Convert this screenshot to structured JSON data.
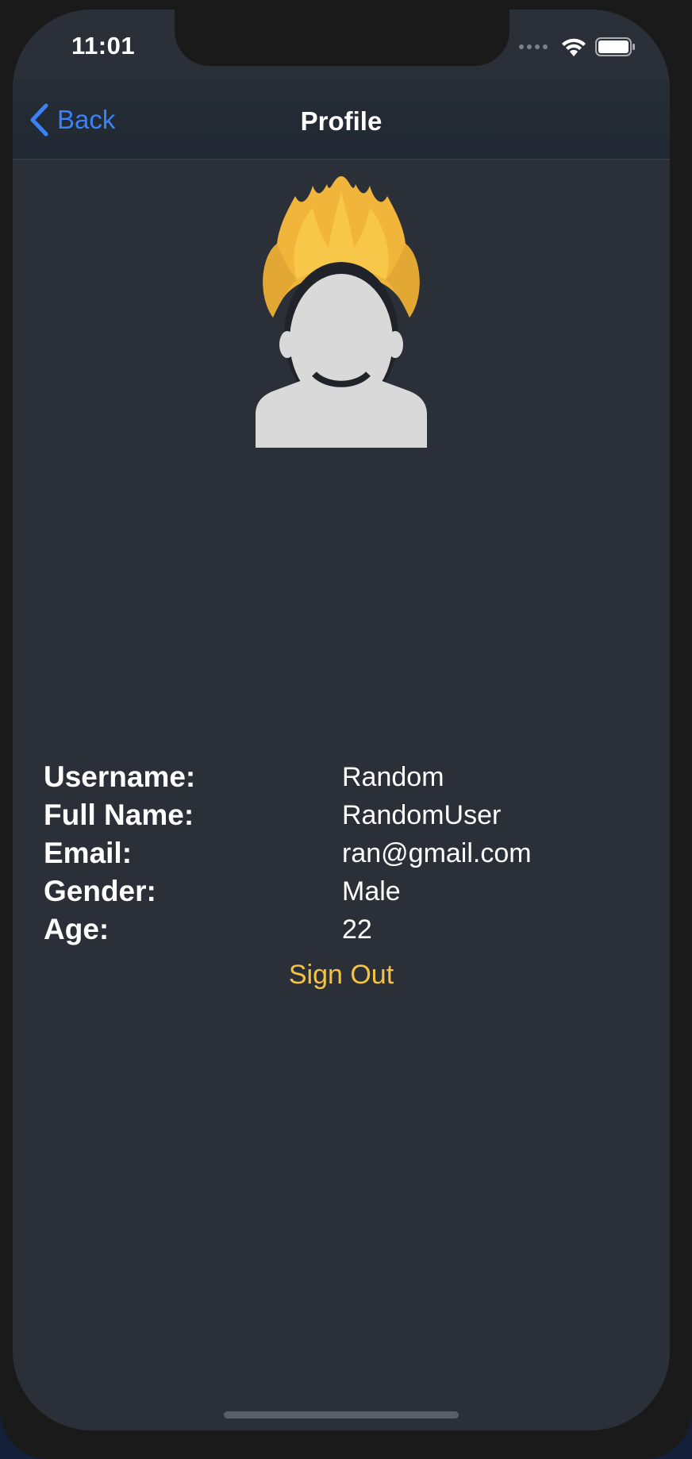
{
  "status_bar": {
    "time": "11:01",
    "icons": [
      "cellular-signal-icon",
      "wifi-icon",
      "battery-icon"
    ]
  },
  "nav_bar": {
    "back_label": "Back",
    "title": "Profile"
  },
  "avatar": {
    "icon": "user-avatar-icon",
    "hair_color": "#f5c242",
    "silhouette_color": "#d9d9d9"
  },
  "profile": {
    "rows": [
      {
        "label": "Username:",
        "value": "Random"
      },
      {
        "label": "Full Name:",
        "value": "RandomUser"
      },
      {
        "label": "Email:",
        "value": "ran@gmail.com"
      },
      {
        "label": "Gender:",
        "value": "Male"
      },
      {
        "label": "Age:",
        "value": "22"
      }
    ]
  },
  "actions": {
    "sign_out_label": "Sign Out"
  },
  "colors": {
    "background": "#2b3038",
    "accent_blue": "#3b82f6",
    "accent_yellow": "#f5c242"
  }
}
